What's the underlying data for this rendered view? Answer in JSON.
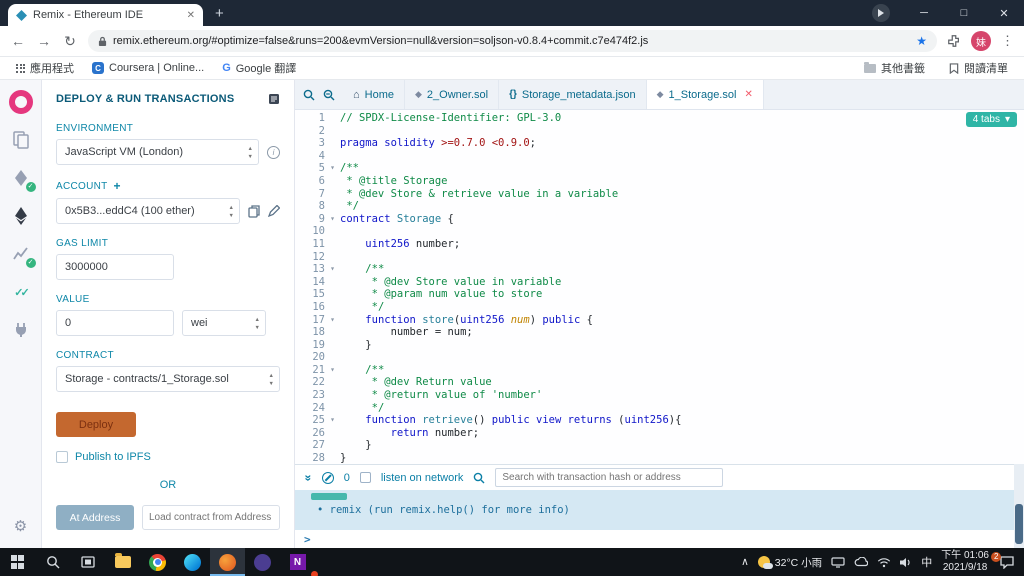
{
  "browser": {
    "tab": {
      "title": "Remix - Ethereum IDE"
    },
    "url": "remix.ethereum.org/#optimize=false&runs=200&evmVersion=null&version=soljson-v0.8.4+commit.c7e474f2.js",
    "avatar_text": "妹",
    "bookmarks_bar": {
      "apps_label": "應用程式",
      "items": [
        {
          "label": "Coursera | Online...",
          "favicon": "C"
        },
        {
          "label": "Google 翻譯",
          "favicon": "G"
        }
      ],
      "other_bookmarks": "其他書籤",
      "reading_list": "閱讀清單"
    }
  },
  "deploy_panel": {
    "title": "DEPLOY & RUN TRANSACTIONS",
    "environment": {
      "label": "ENVIRONMENT",
      "value": "JavaScript VM (London)"
    },
    "account": {
      "label": "ACCOUNT",
      "value": "0x5B3...eddC4 (100 ether)"
    },
    "gas_limit": {
      "label": "GAS LIMIT",
      "value": "3000000"
    },
    "value": {
      "label": "VALUE",
      "amount": "0",
      "unit": "wei"
    },
    "contract": {
      "label": "CONTRACT",
      "value": "Storage - contracts/1_Storage.sol"
    },
    "deploy_button": "Deploy",
    "publish_checkbox": "Publish to IPFS",
    "or_divider": "OR",
    "at_address_button": "At Address",
    "at_address_placeholder": "Load contract from Address"
  },
  "editor": {
    "tabs": [
      {
        "label": "Home",
        "icon": "home"
      },
      {
        "label": "2_Owner.sol",
        "icon": "solidity"
      },
      {
        "label": "Storage_metadata.json",
        "icon": "json"
      },
      {
        "label": "1_Storage.sol",
        "icon": "solidity",
        "active": true,
        "closable": true
      }
    ],
    "tabs_badge": "4 tabs",
    "lines": [
      {
        "n": 1,
        "s": [
          [
            "c",
            "// SPDX-License-Identifier: GPL-3.0"
          ]
        ]
      },
      {
        "n": 2,
        "s": []
      },
      {
        "n": 3,
        "s": [
          [
            "k",
            "pragma solidity "
          ],
          [
            "n",
            ">=0.7.0 <0.9.0"
          ],
          [
            "p",
            ";"
          ]
        ]
      },
      {
        "n": 4,
        "s": []
      },
      {
        "n": 5,
        "fold": true,
        "s": [
          [
            "c",
            "/**"
          ]
        ]
      },
      {
        "n": 6,
        "s": [
          [
            "c",
            " * @title Storage"
          ]
        ]
      },
      {
        "n": 7,
        "s": [
          [
            "c",
            " * @dev Store & retrieve value in a variable"
          ]
        ]
      },
      {
        "n": 8,
        "s": [
          [
            "c",
            " */"
          ]
        ]
      },
      {
        "n": 9,
        "fold": true,
        "s": [
          [
            "k",
            "contract "
          ],
          [
            "t",
            "Storage"
          ],
          [
            "p",
            " {"
          ]
        ]
      },
      {
        "n": 10,
        "s": []
      },
      {
        "n": 11,
        "s": [
          [
            "p",
            "    "
          ],
          [
            "k",
            "uint256"
          ],
          [
            "p",
            " number;"
          ]
        ]
      },
      {
        "n": 12,
        "s": []
      },
      {
        "n": 13,
        "fold": true,
        "s": [
          [
            "p",
            "    "
          ],
          [
            "c",
            "/**"
          ]
        ]
      },
      {
        "n": 14,
        "s": [
          [
            "p",
            "    "
          ],
          [
            "c",
            " * @dev Store value in variable"
          ]
        ]
      },
      {
        "n": 15,
        "s": [
          [
            "p",
            "    "
          ],
          [
            "c",
            " * @param num value to store"
          ]
        ]
      },
      {
        "n": 16,
        "s": [
          [
            "p",
            "    "
          ],
          [
            "c",
            " */"
          ]
        ]
      },
      {
        "n": 17,
        "fold": true,
        "s": [
          [
            "p",
            "    "
          ],
          [
            "k",
            "function "
          ],
          [
            "f",
            "store"
          ],
          [
            "p",
            "("
          ],
          [
            "k",
            "uint256"
          ],
          [
            "m",
            " num"
          ],
          [
            "p",
            ") "
          ],
          [
            "k",
            "public"
          ],
          [
            "p",
            " {"
          ]
        ]
      },
      {
        "n": 18,
        "s": [
          [
            "p",
            "        number = num;"
          ]
        ]
      },
      {
        "n": 19,
        "s": [
          [
            "p",
            "    }"
          ]
        ]
      },
      {
        "n": 20,
        "s": []
      },
      {
        "n": 21,
        "fold": true,
        "s": [
          [
            "p",
            "    "
          ],
          [
            "c",
            "/**"
          ]
        ]
      },
      {
        "n": 22,
        "s": [
          [
            "p",
            "    "
          ],
          [
            "c",
            " * @dev Return value"
          ]
        ]
      },
      {
        "n": 23,
        "s": [
          [
            "p",
            "    "
          ],
          [
            "c",
            " * @return value of 'number'"
          ]
        ]
      },
      {
        "n": 24,
        "s": [
          [
            "p",
            "    "
          ],
          [
            "c",
            " */"
          ]
        ]
      },
      {
        "n": 25,
        "fold": true,
        "s": [
          [
            "p",
            "    "
          ],
          [
            "k",
            "function "
          ],
          [
            "f",
            "retrieve"
          ],
          [
            "p",
            "() "
          ],
          [
            "k",
            "public view returns"
          ],
          [
            "p",
            " ("
          ],
          [
            "k",
            "uint256"
          ],
          [
            "p",
            "){"
          ]
        ]
      },
      {
        "n": 26,
        "s": [
          [
            "p",
            "        "
          ],
          [
            "k",
            "return"
          ],
          [
            "p",
            " number;"
          ]
        ]
      },
      {
        "n": 27,
        "s": [
          [
            "p",
            "    }"
          ]
        ]
      },
      {
        "n": 28,
        "s": [
          [
            "p",
            "}"
          ]
        ]
      }
    ]
  },
  "terminal": {
    "badge_count": "0",
    "listen_label": "listen on network",
    "search_placeholder": "Search with transaction hash or address",
    "log_bullet": "•",
    "log_line": "remix (run remix.help() for more info)",
    "prompt": ">"
  },
  "taskbar": {
    "weather": "32°C 小雨",
    "ime": "中",
    "time": "下午 01:06",
    "date": "2021/9/18",
    "notification_badge": "2",
    "onenote_letter": "N"
  },
  "icons": {
    "back": "←",
    "forward": "→",
    "reload": "↻",
    "close": "✕",
    "new_tab": "+",
    "menu": "⋮",
    "star": "★",
    "home": "⌂",
    "solidity": "◆",
    "json": "{}",
    "caret_down": "▾",
    "check": "✓",
    "double_check": "✓✓",
    "plus": "+",
    "info": "i",
    "double_chevron": "»",
    "chevron_up": "∧",
    "gear": "⚙"
  }
}
